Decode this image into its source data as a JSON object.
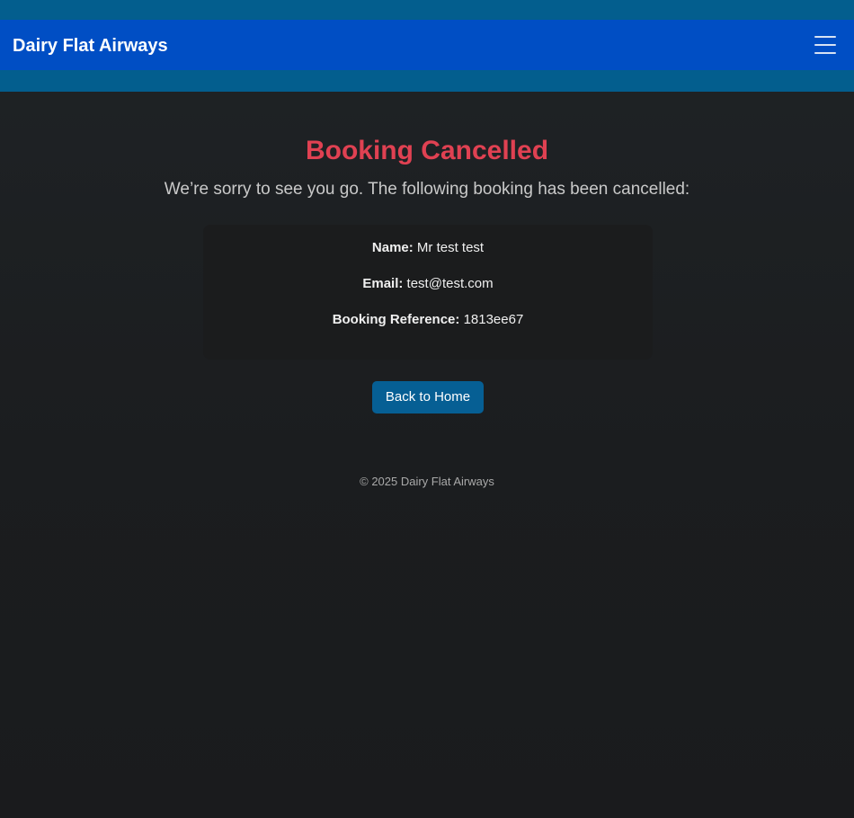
{
  "navbar": {
    "brand": "Dairy Flat Airways",
    "menu_icon": "hamburger-icon"
  },
  "main": {
    "title": "Booking Cancelled",
    "subtitle": "We’re sorry to see you go. The following booking has been cancelled:",
    "details": {
      "name_label": "Name:",
      "name_value": "Mr test test",
      "email_label": "Email:",
      "email_value": "test@test.com",
      "ref_label": "Booking Reference:",
      "ref_value": "1813ee67"
    },
    "home_button": "Back to Home"
  },
  "footer": {
    "copyright": "© 2025 Dairy Flat Airways"
  },
  "colors": {
    "header_band": "#035e8e",
    "navbar": "#004ec4",
    "title": "#e04152",
    "button": "#065f94",
    "background": "#1b1d1f"
  }
}
